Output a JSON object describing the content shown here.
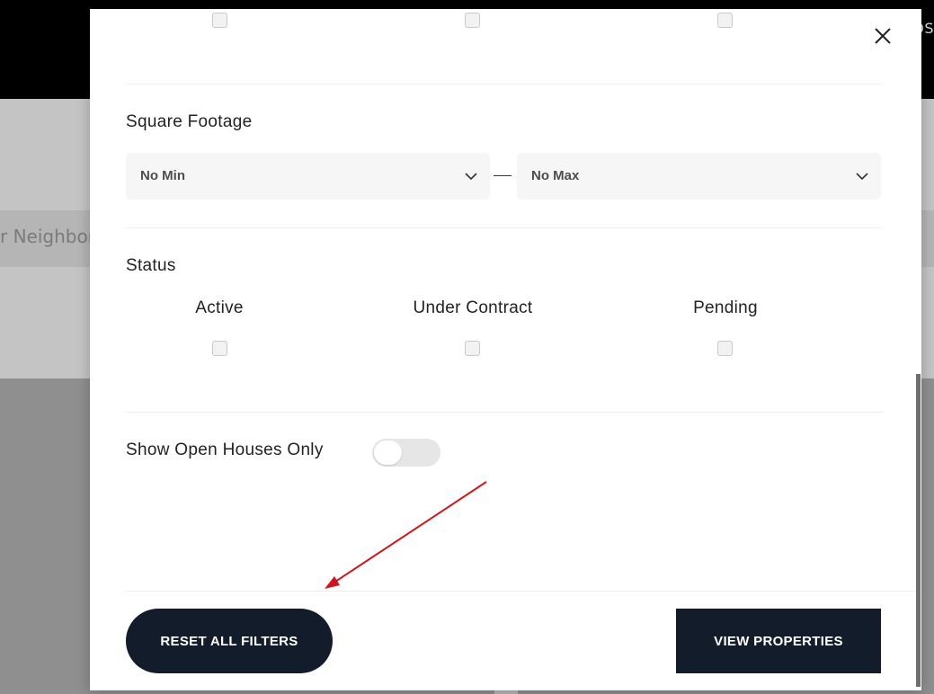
{
  "background": {
    "header_text": "OS",
    "search_text": "r Neighbor"
  },
  "modal": {
    "close_icon": "close-icon",
    "square_footage": {
      "title": "Square Footage",
      "min_value": "No Min",
      "max_value": "No Max"
    },
    "status": {
      "title": "Status",
      "options": [
        {
          "label": "Active",
          "checked": false
        },
        {
          "label": "Under Contract",
          "checked": false
        },
        {
          "label": "Pending",
          "checked": false
        }
      ]
    },
    "open_houses": {
      "label": "Show Open Houses Only",
      "enabled": false
    },
    "buttons": {
      "reset": "RESET ALL FILTERS",
      "view": "VIEW PROPERTIES"
    }
  },
  "colors": {
    "button_bg": "#131c2b",
    "annotation_arrow": "#d0161b"
  }
}
